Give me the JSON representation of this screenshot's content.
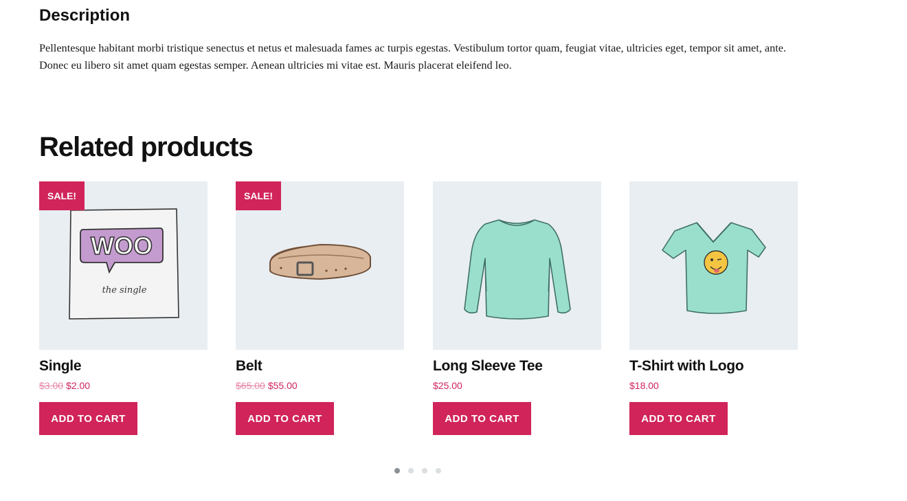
{
  "description": {
    "title": "Description",
    "text": "Pellentesque habitant morbi tristique senectus et netus et malesuada fames ac turpis egestas. Vestibulum tortor quam, feugiat vitae, ultricies eget, tempor sit amet, ante. Donec eu libero sit amet quam egestas semper. Aenean ultricies mi vitae est. Mauris placerat eleifend leo."
  },
  "related": {
    "title": "Related products",
    "products": [
      {
        "name": "Single",
        "sale_badge": "SALE!",
        "old_price": "$3.00",
        "price": "$2.00",
        "button": "ADD TO CART",
        "image_text_logo": "WOO",
        "image_text_caption": "the single"
      },
      {
        "name": "Belt",
        "sale_badge": "SALE!",
        "old_price": "$65.00",
        "price": "$55.00",
        "button": "ADD TO CART"
      },
      {
        "name": "Long Sleeve Tee",
        "price": "$25.00",
        "button": "ADD TO CART"
      },
      {
        "name": "T-Shirt with Logo",
        "price": "$18.00",
        "button": "ADD TO CART"
      }
    ]
  },
  "carousel": {
    "page_count": 4,
    "active_page": 1
  },
  "colors": {
    "accent": "#d0245a",
    "image_background": "#e9eef2",
    "text": "#111111",
    "dot_active": "#8a9297",
    "dot_inactive": "#dcdfe1"
  }
}
